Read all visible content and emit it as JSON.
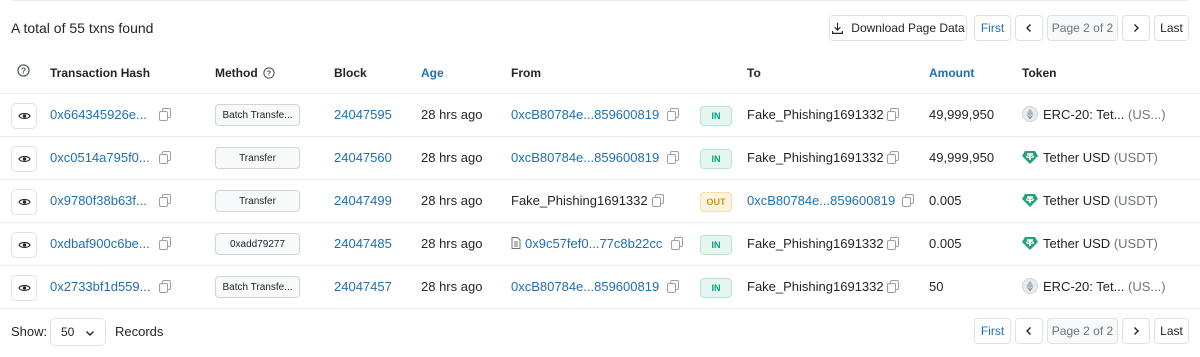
{
  "header": {
    "summary": "A total of 55 txns found",
    "download_label": "Download Page Data",
    "pager": {
      "first": "First",
      "page": "Page 2 of 2",
      "last": "Last"
    }
  },
  "columns": {
    "hash": "Transaction Hash",
    "method": "Method",
    "block": "Block",
    "age": "Age",
    "from": "From",
    "to": "To",
    "amount": "Amount",
    "token": "Token"
  },
  "rows": [
    {
      "hash": "0x664345926e...",
      "method": "Batch Transfe...",
      "block": "24047595",
      "age": "28 hrs ago",
      "from": "0xcB80784e...859600819",
      "direction": "IN",
      "to": "Fake_Phishing1691332",
      "amount": "49,999,950",
      "token": "ERC-20: Tet...",
      "token_suffix": "(US...)",
      "token_icon": "erc20-token-icon"
    },
    {
      "hash": "0xc0514a795f0...",
      "method": "Transfer",
      "block": "24047560",
      "age": "28 hrs ago",
      "from": "0xcB80784e...859600819",
      "direction": "IN",
      "to": "Fake_Phishing1691332",
      "amount": "49,999,950",
      "token": "Tether USD",
      "token_suffix": "(USDT)",
      "token_icon": "tether-icon"
    },
    {
      "hash": "0x9780f38b63f...",
      "method": "Transfer",
      "block": "24047499",
      "age": "28 hrs ago",
      "from": "Fake_Phishing1691332",
      "direction": "OUT",
      "to": "0xcB80784e...859600819",
      "amount": "0.005",
      "token": "Tether USD",
      "token_suffix": "(USDT)",
      "token_icon": "tether-icon"
    },
    {
      "hash": "0xdbaf900c6be...",
      "method": "0xadd79277",
      "block": "24047485",
      "age": "28 hrs ago",
      "from": "0x9c57fef0...77c8b22cc",
      "direction": "IN",
      "to": "Fake_Phishing1691332",
      "amount": "0.005",
      "token": "Tether USD",
      "token_suffix": "(USDT)",
      "token_icon": "tether-icon"
    },
    {
      "hash": "0x2733bf1d559...",
      "method": "Batch Transfe...",
      "block": "24047457",
      "age": "28 hrs ago",
      "from": "0xcB80784e...859600819",
      "direction": "IN",
      "to": "Fake_Phishing1691332",
      "amount": "50",
      "token": "ERC-20: Tet...",
      "token_suffix": "(US...)",
      "token_icon": "erc20-token-icon"
    }
  ],
  "footer": {
    "show_label": "Show:",
    "page_size": "50",
    "records_label": "Records",
    "pager": {
      "first": "First",
      "page": "Page 2 of 2",
      "last": "Last"
    }
  },
  "colors": {
    "link": "#1e6fb5",
    "in": "#00a186",
    "out": "#cc9a06",
    "tether": "#26a17b"
  }
}
